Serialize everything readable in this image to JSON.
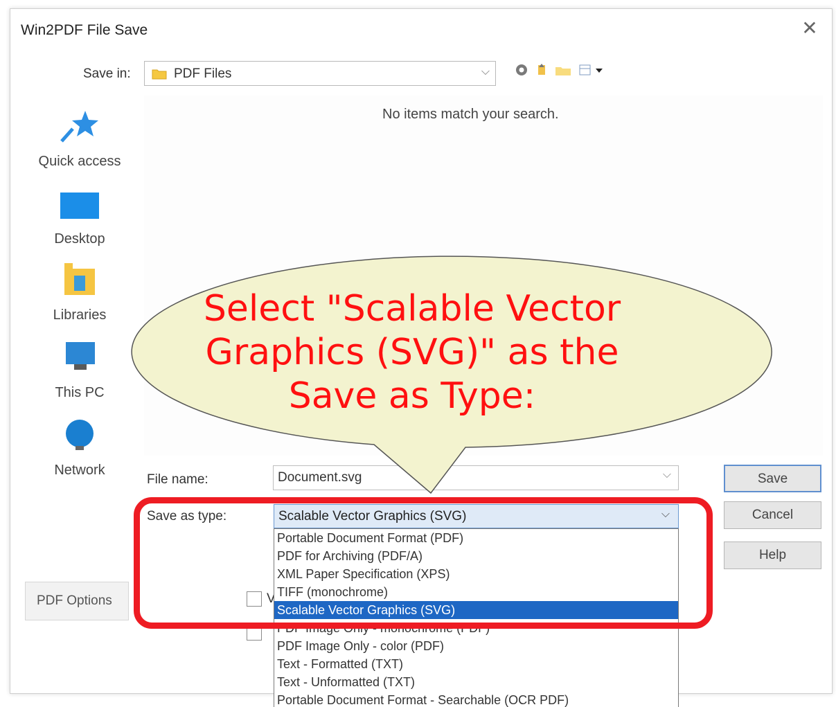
{
  "window": {
    "title": "Win2PDF File Save",
    "close_glyph": "✕"
  },
  "save_in": {
    "label": "Save in:",
    "value": "PDF Files",
    "chevron": "⌵"
  },
  "places": [
    {
      "label": "Quick access",
      "icon": "quick-access-star-icon"
    },
    {
      "label": "Desktop",
      "icon": "desktop-icon"
    },
    {
      "label": "Libraries",
      "icon": "libraries-icon"
    },
    {
      "label": "This PC",
      "icon": "this-pc-icon"
    },
    {
      "label": "Network",
      "icon": "network-icon"
    }
  ],
  "file_list": {
    "empty_message": "No items match your search."
  },
  "file_name": {
    "label": "File name:",
    "value": "Document.svg",
    "chevron": "⌵"
  },
  "save_as_type": {
    "label": "Save as type:",
    "value": "Scalable Vector Graphics (SVG)",
    "chevron": "⌵",
    "options": [
      "Portable Document Format (PDF)",
      "PDF for Archiving (PDF/A)",
      "XML Paper Specification (XPS)",
      "TIFF (monochrome)",
      "Scalable Vector Graphics (SVG)",
      "PDF Image Only - monochrome (PDF)",
      "PDF Image Only - color (PDF)",
      "Text - Formatted (TXT)",
      "Text - Unformatted (TXT)",
      "Portable Document Format - Searchable (OCR PDF)"
    ],
    "selected_index": 4
  },
  "buttons": {
    "save": "Save",
    "cancel": "Cancel",
    "help": "Help"
  },
  "pdf_options": {
    "label": "PDF Options"
  },
  "hidden_checkbox": {
    "label_fragment": "V"
  },
  "callout": {
    "lines": [
      "Select \"Scalable Vector",
      "Graphics (SVG)\" as the",
      "Save as Type:"
    ],
    "text_color": "#ff1010",
    "fill_color": "#f3f3cf"
  },
  "highlight_color": "#ee1c23",
  "selection_color": "#1e67c4"
}
